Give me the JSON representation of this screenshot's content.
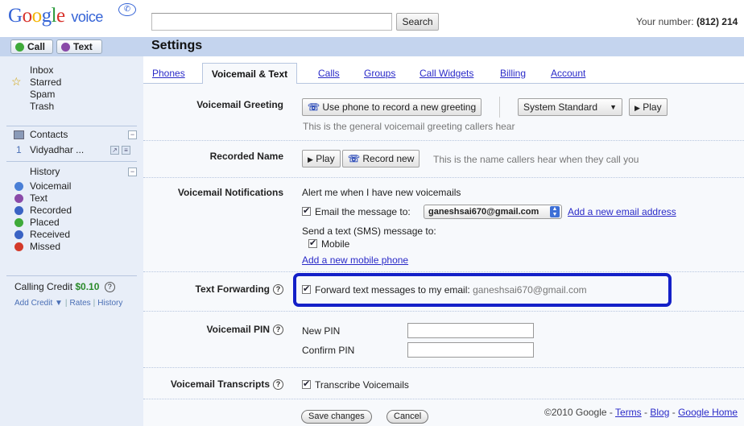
{
  "header": {
    "logo_voice": "voice",
    "search_placeholder": "",
    "search_button": "Search",
    "your_number_label": "Your number:",
    "your_number_value": "(812) 214"
  },
  "sidebar": {
    "call_label": "Call",
    "text_label": "Text",
    "folders": [
      "Inbox",
      "Starred",
      "Spam",
      "Trash"
    ],
    "contacts_label": "Contacts",
    "contact_count": "1",
    "contact_name": "Vidyadhar ...",
    "history_label": "History",
    "history_items": [
      {
        "label": "Voicemail",
        "color": "#4a7fd6"
      },
      {
        "label": "Text",
        "color": "#8a4aa8"
      },
      {
        "label": "Recorded",
        "color": "#3a63c4"
      },
      {
        "label": "Placed",
        "color": "#3faa3a"
      },
      {
        "label": "Received",
        "color": "#3a63c4"
      },
      {
        "label": "Missed",
        "color": "#d33a2a"
      }
    ],
    "calling_credit_label": "Calling Credit",
    "calling_credit_value": "$0.10",
    "add_credit": "Add Credit ▼",
    "rates": "Rates",
    "history_link": "History"
  },
  "settings": {
    "title": "Settings",
    "tabs": {
      "phones": "Phones",
      "voicemail_text": "Voicemail & Text",
      "calls": "Calls",
      "groups": "Groups",
      "call_widgets": "Call Widgets",
      "billing": "Billing",
      "account": "Account"
    },
    "voicemail_greeting": {
      "label": "Voicemail Greeting",
      "record_button": "Use phone to record a new greeting",
      "select_value": "System Standard",
      "play_button": "Play",
      "hint": "This is the general voicemail greeting callers hear"
    },
    "recorded_name": {
      "label": "Recorded Name",
      "play_button": "Play",
      "record_button": "Record new",
      "hint": "This is the name callers hear when they call you"
    },
    "voicemail_notifications": {
      "label": "Voicemail Notifications",
      "alert_text": "Alert me when I have new voicemails",
      "email_text": "Email the message to:",
      "email_value": "ganeshsai670@gmail.com",
      "add_email_link": "Add a new email address",
      "sms_text": "Send a text (SMS) message to:",
      "mobile_label": "Mobile",
      "add_mobile_link": "Add a new mobile phone"
    },
    "text_forwarding": {
      "label": "Text Forwarding",
      "text": "Forward text messages to my email:",
      "email": "ganeshsai670@gmail.com"
    },
    "voicemail_pin": {
      "label": "Voicemail PIN",
      "new_pin": "New PIN",
      "confirm_pin": "Confirm PIN"
    },
    "voicemail_transcripts": {
      "label": "Voicemail Transcripts",
      "text": "Transcribe Voicemails"
    },
    "save_button": "Save changes",
    "cancel_button": "Cancel"
  },
  "footer": {
    "copyright": "©2010 Google - ",
    "terms": "Terms",
    "blog": "Blog",
    "google_home": "Google Home",
    "sep": " - "
  }
}
